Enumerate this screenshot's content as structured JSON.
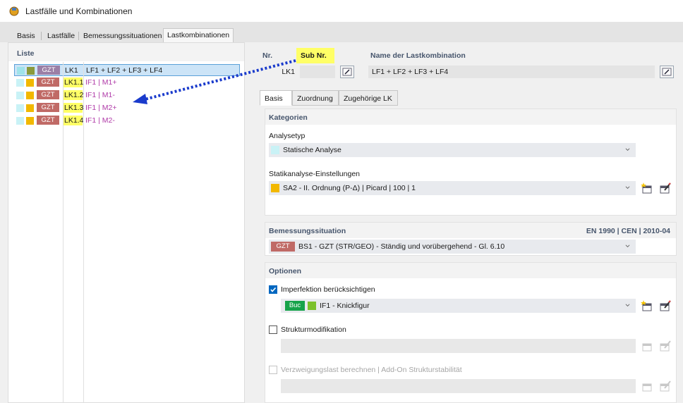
{
  "window": {
    "title": "Lastfälle und Kombinationen"
  },
  "tabs": [
    "Basis",
    "Lastfälle",
    "Bemessungssituationen",
    "Lastkombinationen"
  ],
  "list": {
    "header": "Liste",
    "rows": [
      {
        "badge": "GZT",
        "id": "LK1",
        "name": "LF1 + LF2 + LF3 + LF4",
        "c1": "#9fe3ea",
        "c2": "#8a9a3c",
        "badge_color": "#9b7fa6",
        "id_highlight": false
      },
      {
        "badge": "GZT",
        "id": "LK1.1",
        "name": "IF1 | M1+",
        "c1": "#c9f2f6",
        "c2": "#f2b800",
        "badge_color": "#c06a66",
        "id_highlight": true
      },
      {
        "badge": "GZT",
        "id": "LK1.2",
        "name": "IF1 | M1-",
        "c1": "#c9f2f6",
        "c2": "#f2b800",
        "badge_color": "#c06a66",
        "id_highlight": true
      },
      {
        "badge": "GZT",
        "id": "LK1.3",
        "name": "IF1 | M2+",
        "c1": "#c9f2f6",
        "c2": "#f2b800",
        "badge_color": "#c06a66",
        "id_highlight": true
      },
      {
        "badge": "GZT",
        "id": "LK1.4",
        "name": "IF1 | M2-",
        "c1": "#c9f2f6",
        "c2": "#f2b800",
        "badge_color": "#c06a66",
        "id_highlight": true
      }
    ]
  },
  "header_fields": {
    "nr_label": "Nr.",
    "sub_nr_label": "Sub Nr.",
    "nr_value": "LK1",
    "name_label": "Name der Lastkombination",
    "name_value": "LF1 + LF2 + LF3 + LF4"
  },
  "inner_tabs": [
    "Basis",
    "Zuordnung",
    "Zugehörige LK"
  ],
  "kategorien": {
    "title": "Kategorien",
    "analysetyp_label": "Analysetyp",
    "analysetyp_value": "Statische Analyse",
    "settings_label": "Statikanalyse-Einstellungen",
    "settings_value": "SA2 - II. Ordnung (P-Δ) | Picard | 100 | 1"
  },
  "bemessung": {
    "title": "Bemessungssituation",
    "standard": "EN 1990 | CEN | 2010-04",
    "badge": "GZT",
    "value": "BS1 - GZT (STR/GEO) - Ständig und vorübergehend - Gl. 6.10"
  },
  "optionen": {
    "title": "Optionen",
    "imperfektion_label": "Imperfektion berücksichtigen",
    "imperfektion_checked": true,
    "imperfektion_badge": "Buc",
    "imperfektion_value": "IF1 - Knickfigur",
    "struktur_label": "Strukturmodifikation",
    "struktur_checked": false,
    "verzweigung_label": "Verzweigungslast berechnen | Add-On Strukturstabilität",
    "verzweigung_checked": false
  },
  "colors": {
    "accent": "#0067c0",
    "highlight": "#ffff66",
    "arrow": "#1a3bcc",
    "section_title": "#46556c"
  }
}
